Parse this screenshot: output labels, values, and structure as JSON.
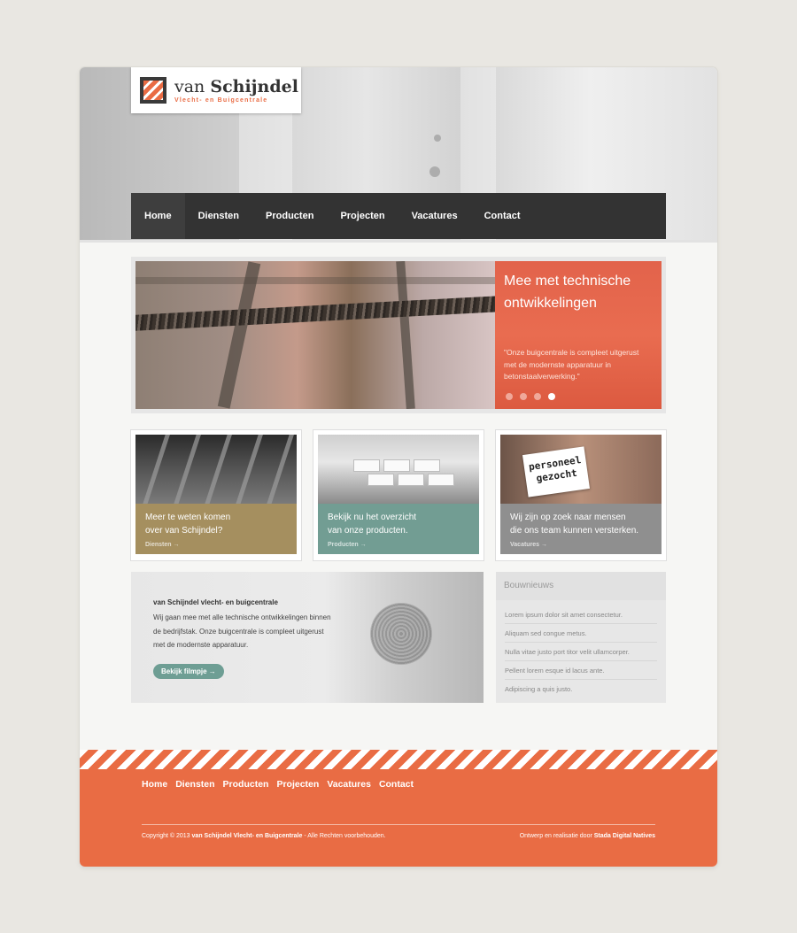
{
  "logo": {
    "name_light": "van",
    "name_bold": "Schijndel",
    "tagline": "Vlecht- en Buigcentrale",
    "icon": "diagonal-stripes-logo-icon"
  },
  "nav": {
    "items": [
      "Home",
      "Diensten",
      "Producten",
      "Projecten",
      "Vacatures",
      "Contact"
    ],
    "active": "Home"
  },
  "slider": {
    "title": "Mee met technische ontwikkelingen",
    "text": "\"Onze buigcentrale is compleet uitgerust met de modernste apparatuur in betonstaalverwerking.\"",
    "slide_count": 4,
    "active_slide": 4
  },
  "boxes": [
    {
      "line1": "Meer te weten komen",
      "line2": "over van Schijndel?",
      "more": "Diensten",
      "arrow": "→"
    },
    {
      "line1": "Bekijk nu het overzicht",
      "line2": "van onze producten.",
      "more": "Producten",
      "arrow": "→"
    },
    {
      "line1": "Wij zijn op zoek naar mensen",
      "line2": "die ons team kunnen versterken.",
      "more": "Vacatures",
      "arrow": "→",
      "card_line1": "personeel",
      "card_line2": "gezocht"
    }
  ],
  "about": {
    "title": "van Schijndel vlecht- en buigcentrale",
    "text": "Wij gaan mee met alle technische ontwikkelingen binnen de bedrijfstak. Onze buigcentrale is compleet uitgerust met de modernste apparatuur.",
    "button": "Bekijk filmpje  →"
  },
  "news": {
    "title": "Bouwnieuws",
    "items": [
      "Lorem ipsum dolor sit amet consectetur.",
      "Aliquam sed congue metus.",
      "Nulla vitae justo port titor velit ullamcorper.",
      "Pellent lorem esque id lacus ante.",
      "Adipiscing a quis justo."
    ]
  },
  "footer": {
    "nav": [
      "Home",
      "Diensten",
      "Producten",
      "Projecten",
      "Vacatures",
      "Contact"
    ],
    "copyright_prefix": "Copyright © 2013 ",
    "copyright_company": "van Schijndel Vlecht- en Buigcentrale",
    "copyright_suffix": " - Alle Rechten voorbehouden.",
    "credit_prefix": "Ontwerp en realisatie door ",
    "credit_company": "Stada Digital Natives"
  },
  "colors": {
    "accent": "#e96c44",
    "nav_bg": "#333333",
    "box1": "#a58f5f",
    "box2": "#729d93",
    "box3": "#8f8f8f"
  }
}
